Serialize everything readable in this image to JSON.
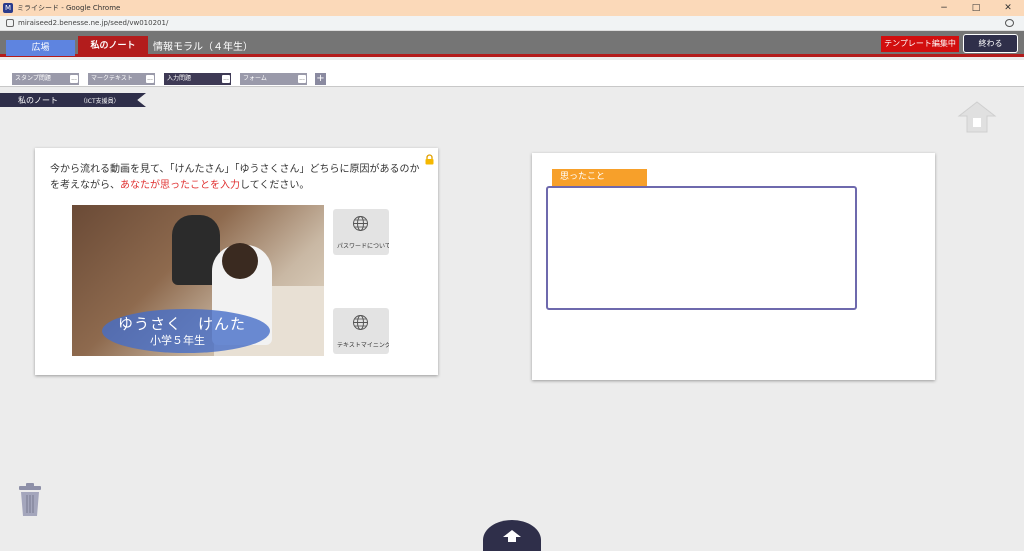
{
  "window": {
    "title": "ミライシード - Google Chrome",
    "minimize": "−",
    "maximize": "□",
    "close": "✕"
  },
  "address": {
    "url": "miraiseed2.benesse.ne.jp/seed/vw010201/"
  },
  "appbar": {
    "tab_hiroba": "広場",
    "tab_note": "私のノート",
    "page_title": "情報モラル（４年生）",
    "template_badge": "テンプレート編集中",
    "finish_button": "終わる"
  },
  "toolbar": {
    "tabs": [
      {
        "label": "スタンプ問題",
        "menu": "..."
      },
      {
        "label": "マークテキスト",
        "menu": "..."
      },
      {
        "label": "入力問題",
        "menu": "..."
      },
      {
        "label": "フォーム",
        "menu": "..."
      }
    ],
    "add": "+"
  },
  "ribbon": {
    "title": "私のノート",
    "subtitle": "（ICT支援員）"
  },
  "card1": {
    "question_part1": "今から流れる動画を見て、「けんたさん」「ゆうさくさん」どちらに原因があるのかを考えながら、",
    "question_red": "あなたが思ったことを入力",
    "question_part2": "してください。",
    "video_caption_names": "ゆうさく　けんた",
    "video_caption_grade": "小学５年生",
    "link1_label": "パスワードについて",
    "link2_label": "テキストマイニング"
  },
  "card2": {
    "note_label": "思ったこと",
    "note_value": ""
  },
  "colors": {
    "accent_red": "#b31c1c",
    "badge_red": "#d20e0e",
    "navy": "#2f2f4a",
    "orange_tag": "#f7a02a",
    "input_border": "#6e69ad",
    "highlight_text": "#e03030"
  },
  "icons": {
    "lock": "lock-icon",
    "globe": "globe-icon",
    "trash": "trash-icon",
    "up": "up-arrow-icon"
  }
}
